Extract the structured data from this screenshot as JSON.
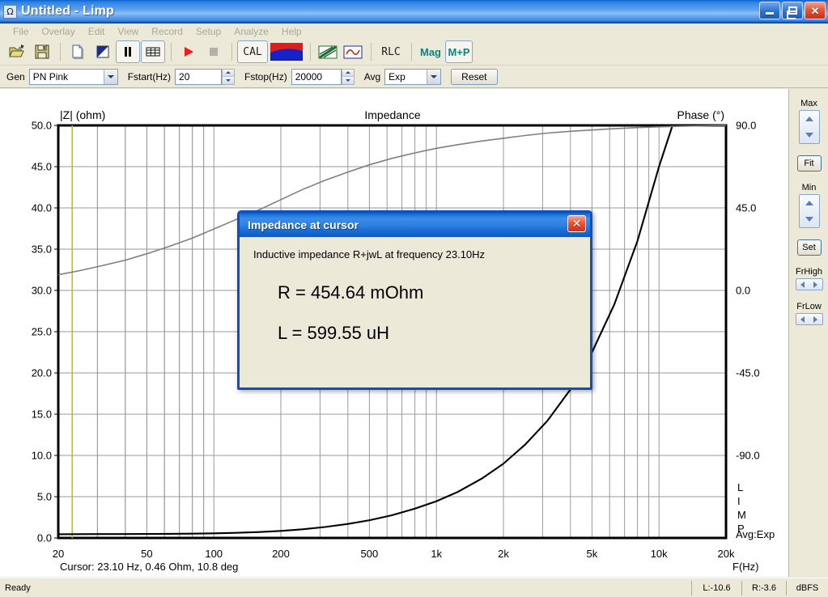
{
  "window": {
    "title": "Untitled - Limp",
    "icon": "omega-icon",
    "buttons": {
      "minimize": "minimize-button",
      "maximize": "maximize-button",
      "close": "close-button"
    }
  },
  "menu": {
    "items": [
      "File",
      "Overlay",
      "Edit",
      "View",
      "Record",
      "Setup",
      "Analyze",
      "Help"
    ]
  },
  "toolbar": {
    "items": [
      {
        "name": "open-icon",
        "kind": "icon",
        "label": ""
      },
      {
        "name": "save-icon",
        "kind": "icon",
        "label": ""
      },
      {
        "name": "new-file-icon",
        "kind": "icon",
        "label": ""
      },
      {
        "name": "overlay-icon",
        "kind": "icon",
        "label": ""
      },
      {
        "name": "pause-icon",
        "kind": "icon",
        "label": ""
      },
      {
        "name": "grid-icon",
        "kind": "icon",
        "label": ""
      },
      {
        "name": "play-icon",
        "kind": "icon",
        "label": ""
      },
      {
        "name": "stop-icon",
        "kind": "icon",
        "label": ""
      },
      {
        "name": "calibrate-button",
        "kind": "text",
        "label": "CAL"
      },
      {
        "name": "colorbar-icon",
        "kind": "icon",
        "label": ""
      },
      {
        "name": "diagonal-icon",
        "kind": "icon",
        "label": ""
      },
      {
        "name": "waveform-icon",
        "kind": "icon",
        "label": ""
      },
      {
        "name": "rlc-button",
        "kind": "text",
        "label": "RLC"
      },
      {
        "name": "mag-button",
        "kind": "teal",
        "label": "Mag"
      },
      {
        "name": "magphase-button",
        "kind": "teal",
        "label": "M+P"
      }
    ],
    "cal_label": "CAL",
    "rlc_label": "RLC",
    "mag_label": "Mag",
    "mp_label": "M+P"
  },
  "settings": {
    "gen_label": "Gen",
    "gen_value": "PN Pink",
    "fstart_label": "Fstart(Hz)",
    "fstart_value": "20",
    "fstop_label": "Fstop(Hz)",
    "fstop_value": "20000",
    "avg_label": "Avg",
    "avg_value": "Exp",
    "reset_label": "Reset"
  },
  "right_panel": {
    "max_label": "Max",
    "fit_label": "Fit",
    "min_label": "Min",
    "set_label": "Set",
    "frhigh_label": "FrHigh",
    "frlow_label": "FrLow"
  },
  "status": {
    "ready": "Ready",
    "left_level": "L:-10.6",
    "right_level": "R:-3.6",
    "unit": "dBFS"
  },
  "dialog": {
    "title": "Impedance at cursor",
    "close": "✕",
    "description": "Inductive impedance R+jwL at frequency 23.10Hz",
    "r_value": "R = 454.64 mOhm",
    "l_value": "L = 599.55 uH"
  },
  "chart_data": {
    "type": "line",
    "title": "Impedance",
    "ylabel": "|Z| (ohm)",
    "y2label": "Phase (°)",
    "xlabel": "F(Hz)",
    "xscale": "log",
    "xlim": [
      20,
      20000
    ],
    "x_ticks": [
      20,
      50,
      100,
      200,
      500,
      1000,
      2000,
      5000,
      10000,
      20000
    ],
    "x_tick_labels": [
      "20",
      "50",
      "100",
      "200",
      "500",
      "1k",
      "2k",
      "5k",
      "10k",
      "20k"
    ],
    "ylim": [
      0,
      50
    ],
    "y_ticks": [
      0,
      5,
      10,
      15,
      20,
      25,
      30,
      35,
      40,
      45,
      50
    ],
    "y_tick_labels": [
      "0.0",
      "5.0",
      "10.0",
      "15.0",
      "20.0",
      "25.0",
      "30.0",
      "35.0",
      "40.0",
      "45.0",
      "50.0"
    ],
    "y2lim": [
      -135,
      90
    ],
    "y2_ticks": [
      90,
      45,
      0,
      -45,
      -90
    ],
    "y2_tick_labels": [
      "90.0",
      "45.0",
      "0.0",
      "-45.0",
      "-90.0"
    ],
    "grid": true,
    "cursor": {
      "frequency_hz": 23.1,
      "impedance_ohm": 0.46,
      "phase_deg": 10.8,
      "label": "Cursor: 23.10 Hz, 0.46 Ohm, 10.8 deg",
      "color": "#c8bc00"
    },
    "annotations": {
      "avg": "Avg:Exp",
      "watermark": "LIMP"
    },
    "series": [
      {
        "name": "Impedance magnitude",
        "axis": "left",
        "color": "#000000",
        "points": [
          [
            20,
            0.45
          ],
          [
            25,
            0.46
          ],
          [
            31.5,
            0.47
          ],
          [
            40,
            0.47
          ],
          [
            50,
            0.48
          ],
          [
            63,
            0.5
          ],
          [
            80,
            0.52
          ],
          [
            100,
            0.56
          ],
          [
            125,
            0.62
          ],
          [
            160,
            0.72
          ],
          [
            200,
            0.85
          ],
          [
            250,
            1.05
          ],
          [
            315,
            1.32
          ],
          [
            400,
            1.7
          ],
          [
            500,
            2.15
          ],
          [
            630,
            2.75
          ],
          [
            800,
            3.55
          ],
          [
            1000,
            4.45
          ],
          [
            1250,
            5.6
          ],
          [
            1600,
            7.2
          ],
          [
            2000,
            9.0
          ],
          [
            2500,
            11.3
          ],
          [
            3150,
            14.2
          ],
          [
            4000,
            18.0
          ],
          [
            5000,
            22.5
          ],
          [
            6300,
            28.3
          ],
          [
            8000,
            36.0
          ],
          [
            10000,
            45.0
          ],
          [
            11500,
            50.0
          ]
        ]
      },
      {
        "name": "Phase",
        "axis": "right",
        "color": "#7f7f7f",
        "points": [
          [
            20,
            8.5
          ],
          [
            25,
            10.8
          ],
          [
            31.5,
            13.5
          ],
          [
            40,
            16.5
          ],
          [
            50,
            20.0
          ],
          [
            63,
            24.0
          ],
          [
            80,
            28.5
          ],
          [
            100,
            33.5
          ],
          [
            125,
            38.5
          ],
          [
            160,
            44.0
          ],
          [
            200,
            49.5
          ],
          [
            250,
            55.0
          ],
          [
            315,
            60.0
          ],
          [
            400,
            64.5
          ],
          [
            500,
            68.5
          ],
          [
            630,
            72.0
          ],
          [
            800,
            75.0
          ],
          [
            1000,
            77.5
          ],
          [
            1250,
            79.5
          ],
          [
            1600,
            81.5
          ],
          [
            2000,
            83.0
          ],
          [
            2500,
            84.5
          ],
          [
            3150,
            85.8
          ],
          [
            4000,
            86.8
          ],
          [
            5000,
            87.5
          ],
          [
            6300,
            88.2
          ],
          [
            8000,
            88.8
          ],
          [
            10000,
            89.2
          ],
          [
            12500,
            89.5
          ],
          [
            16000,
            89.8
          ],
          [
            20000,
            90.0
          ]
        ]
      }
    ]
  }
}
